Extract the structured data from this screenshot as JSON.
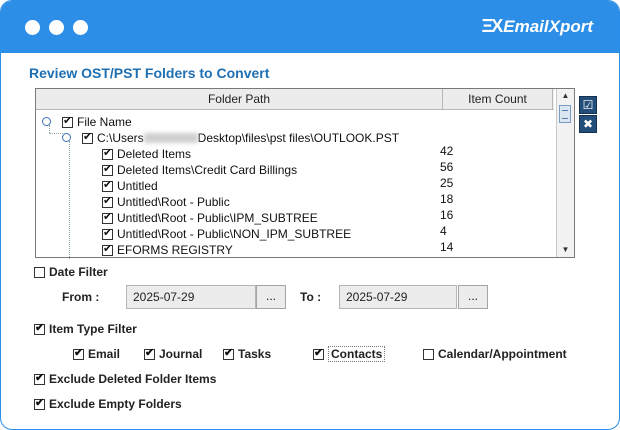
{
  "window": {
    "brand": "EmailXport",
    "brand_mark": "ΞX"
  },
  "heading": "Review OST/PST Folders to Convert",
  "tree": {
    "columns": [
      "Folder Path",
      "Item Count"
    ],
    "root_label": "File Name",
    "pst_path_prefix": "C:\\Users",
    "pst_path_suffix": "Desktop\\files\\pst files\\OUTLOOK.PST",
    "folders": [
      {
        "name": "Deleted Items",
        "count": "42"
      },
      {
        "name": "Deleted Items\\Credit Card Billings",
        "count": "56"
      },
      {
        "name": "Untitled",
        "count": "25"
      },
      {
        "name": "Untitled\\Root - Public",
        "count": "18"
      },
      {
        "name": "Untitled\\Root - Public\\IPM_SUBTREE",
        "count": "16"
      },
      {
        "name": "Untitled\\Root - Public\\NON_IPM_SUBTREE",
        "count": "4"
      },
      {
        "name": "EFORMS REGISTRY",
        "count": "14"
      }
    ]
  },
  "date_filter": {
    "label": "Date Filter",
    "checked": false,
    "from_label": "From :",
    "from_value": "2025-07-29",
    "to_label": "To :",
    "to_value": "2025-07-29",
    "browse_label": "..."
  },
  "item_type_filter": {
    "label": "Item Type Filter",
    "checked": true,
    "types": [
      {
        "label": "Email",
        "checked": true
      },
      {
        "label": "Journal",
        "checked": true
      },
      {
        "label": "Tasks",
        "checked": true
      },
      {
        "label": "Contacts",
        "checked": true
      },
      {
        "label": "Calendar/Appointment",
        "checked": false
      }
    ]
  },
  "exclude_deleted": {
    "label": "Exclude Deleted Folder Items",
    "checked": true
  },
  "exclude_empty": {
    "label": "Exclude Empty Folders",
    "checked": true
  },
  "colors": {
    "titlebar": "#2c8ee6",
    "heading": "#1f6fb3",
    "side_button": "#244e7a"
  }
}
